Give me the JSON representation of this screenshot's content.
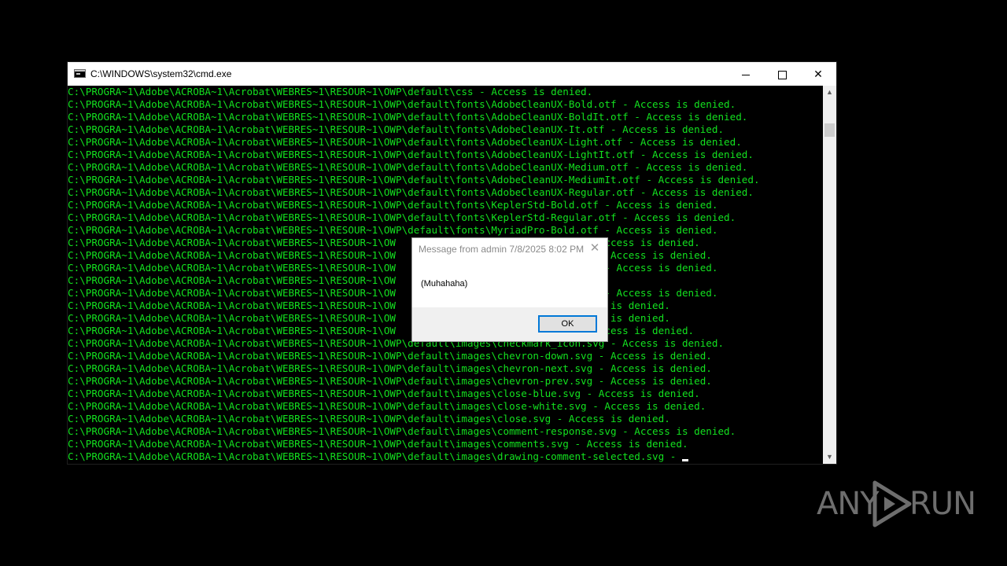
{
  "window": {
    "title": "C:\\WINDOWS\\system32\\cmd.exe",
    "minimize_glyph": "minimize-icon",
    "maximize_glyph": "maximize-icon",
    "close_glyph": "✕"
  },
  "console": {
    "text_color": "#13e11f",
    "lines": [
      "C:\\PROGRA~1\\Adobe\\ACROBA~1\\Acrobat\\WEBRES~1\\RESOUR~1\\OWP\\default\\css - Access is denied.",
      "C:\\PROGRA~1\\Adobe\\ACROBA~1\\Acrobat\\WEBRES~1\\RESOUR~1\\OWP\\default\\fonts\\AdobeCleanUX-Bold.otf - Access is denied.",
      "C:\\PROGRA~1\\Adobe\\ACROBA~1\\Acrobat\\WEBRES~1\\RESOUR~1\\OWP\\default\\fonts\\AdobeCleanUX-BoldIt.otf - Access is denied.",
      "C:\\PROGRA~1\\Adobe\\ACROBA~1\\Acrobat\\WEBRES~1\\RESOUR~1\\OWP\\default\\fonts\\AdobeCleanUX-It.otf - Access is denied.",
      "C:\\PROGRA~1\\Adobe\\ACROBA~1\\Acrobat\\WEBRES~1\\RESOUR~1\\OWP\\default\\fonts\\AdobeCleanUX-Light.otf - Access is denied.",
      "C:\\PROGRA~1\\Adobe\\ACROBA~1\\Acrobat\\WEBRES~1\\RESOUR~1\\OWP\\default\\fonts\\AdobeCleanUX-LightIt.otf - Access is denied.",
      "C:\\PROGRA~1\\Adobe\\ACROBA~1\\Acrobat\\WEBRES~1\\RESOUR~1\\OWP\\default\\fonts\\AdobeCleanUX-Medium.otf - Access is denied.",
      "C:\\PROGRA~1\\Adobe\\ACROBA~1\\Acrobat\\WEBRES~1\\RESOUR~1\\OWP\\default\\fonts\\AdobeCleanUX-MediumIt.otf - Access is denied.",
      "C:\\PROGRA~1\\Adobe\\ACROBA~1\\Acrobat\\WEBRES~1\\RESOUR~1\\OWP\\default\\fonts\\AdobeCleanUX-Regular.otf - Access is denied.",
      "C:\\PROGRA~1\\Adobe\\ACROBA~1\\Acrobat\\WEBRES~1\\RESOUR~1\\OWP\\default\\fonts\\KeplerStd-Bold.otf - Access is denied.",
      "C:\\PROGRA~1\\Adobe\\ACROBA~1\\Acrobat\\WEBRES~1\\RESOUR~1\\OWP\\default\\fonts\\KeplerStd-Regular.otf - Access is denied.",
      "C:\\PROGRA~1\\Adobe\\ACROBA~1\\Acrobat\\WEBRES~1\\RESOUR~1\\OWP\\default\\fonts\\MyriadPro-Bold.otf - Access is denied.",
      "C:\\PROGRA~1\\Adobe\\ACROBA~1\\Acrobat\\WEBRES~1\\RESOUR~1\\OW                           .otf - Access is denied.",
      "C:\\PROGRA~1\\Adobe\\ACROBA~1\\Acrobat\\WEBRES~1\\RESOUR~1\\OW                           ar.otf - Access is denied.",
      "C:\\PROGRA~1\\Adobe\\ACROBA~1\\Acrobat\\WEBRES~1\\RESOUR~1\\OW                           old.otf - Access is denied.",
      "C:\\PROGRA~1\\Adobe\\ACROBA~1\\Acrobat\\WEBRES~1\\RESOUR~1\\OW                           nied.",
      "C:\\PROGRA~1\\Adobe\\ACROBA~1\\Acrobat\\WEBRES~1\\RESOUR~1\\OW                           ron.svg - Access is denied.",
      "C:\\PROGRA~1\\Adobe\\ACROBA~1\\Acrobat\\WEBRES~1\\RESOUR~1\\OW                           - Access is denied.",
      "C:\\PROGRA~1\\Adobe\\ACROBA~1\\Acrobat\\WEBRES~1\\RESOUR~1\\OW                           - Access is denied.",
      "C:\\PROGRA~1\\Adobe\\ACROBA~1\\Acrobat\\WEBRES~1\\RESOUR~1\\OW                           svg - Access is denied.",
      "C:\\PROGRA~1\\Adobe\\ACROBA~1\\Acrobat\\WEBRES~1\\RESOUR~1\\OWP\\default\\images\\checkmark_icon.svg - Access is denied.",
      "C:\\PROGRA~1\\Adobe\\ACROBA~1\\Acrobat\\WEBRES~1\\RESOUR~1\\OWP\\default\\images\\chevron-down.svg - Access is denied.",
      "C:\\PROGRA~1\\Adobe\\ACROBA~1\\Acrobat\\WEBRES~1\\RESOUR~1\\OWP\\default\\images\\chevron-next.svg - Access is denied.",
      "C:\\PROGRA~1\\Adobe\\ACROBA~1\\Acrobat\\WEBRES~1\\RESOUR~1\\OWP\\default\\images\\chevron-prev.svg - Access is denied.",
      "C:\\PROGRA~1\\Adobe\\ACROBA~1\\Acrobat\\WEBRES~1\\RESOUR~1\\OWP\\default\\images\\close-blue.svg - Access is denied.",
      "C:\\PROGRA~1\\Adobe\\ACROBA~1\\Acrobat\\WEBRES~1\\RESOUR~1\\OWP\\default\\images\\close-white.svg - Access is denied.",
      "C:\\PROGRA~1\\Adobe\\ACROBA~1\\Acrobat\\WEBRES~1\\RESOUR~1\\OWP\\default\\images\\close.svg - Access is denied.",
      "C:\\PROGRA~1\\Adobe\\ACROBA~1\\Acrobat\\WEBRES~1\\RESOUR~1\\OWP\\default\\images\\comment-response.svg - Access is denied.",
      "C:\\PROGRA~1\\Adobe\\ACROBA~1\\Acrobat\\WEBRES~1\\RESOUR~1\\OWP\\default\\images\\comments.svg - Access is denied."
    ],
    "last_line": "C:\\PROGRA~1\\Adobe\\ACROBA~1\\Acrobat\\WEBRES~1\\RESOUR~1\\OWP\\default\\images\\drawing-comment-selected.svg - "
  },
  "scrollbar": {
    "up_glyph": "▲",
    "down_glyph": "▼"
  },
  "dialog": {
    "title": "Message from admin 7/8/2025 8:02 PM",
    "close_glyph": "✕",
    "message": "(Muhahaha)",
    "ok_label": "OK"
  },
  "watermark": {
    "left_text": "ANY",
    "right_text": "RUN",
    "logo_icon": "play-triangle-icon"
  }
}
